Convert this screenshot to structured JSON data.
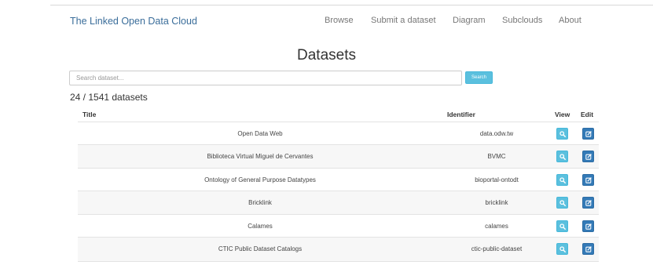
{
  "navbar": {
    "brand": "The Linked Open Data Cloud",
    "links": [
      "Browse",
      "Submit a dataset",
      "Diagram",
      "Subclouds",
      "About"
    ]
  },
  "page": {
    "title": "Datasets",
    "search": {
      "placeholder": "Search dataset...",
      "value": "",
      "button_label": "Search"
    },
    "count": "24 / 1541 datasets"
  },
  "table": {
    "headers": {
      "title": "Title",
      "identifier": "Identifier",
      "view": "View",
      "edit": "Edit"
    },
    "rows": [
      {
        "title": "Open Data Web",
        "identifier": "data.odw.tw"
      },
      {
        "title": "Biblioteca Virtual Miguel de Cervantes",
        "identifier": "BVMC"
      },
      {
        "title": "Ontology of General Purpose Datatypes",
        "identifier": "bioportal-ontodt"
      },
      {
        "title": "Bricklink",
        "identifier": "bricklink"
      },
      {
        "title": "Calames",
        "identifier": "calames"
      },
      {
        "title": "CTIC Public Dataset Catalogs",
        "identifier": "ctic-public-dataset"
      }
    ]
  },
  "icons": {
    "view": "search-icon",
    "edit": "edit-icon"
  },
  "colors": {
    "brand": "#3a6d9a",
    "info": "#5bc0de",
    "primary": "#337ab7"
  }
}
